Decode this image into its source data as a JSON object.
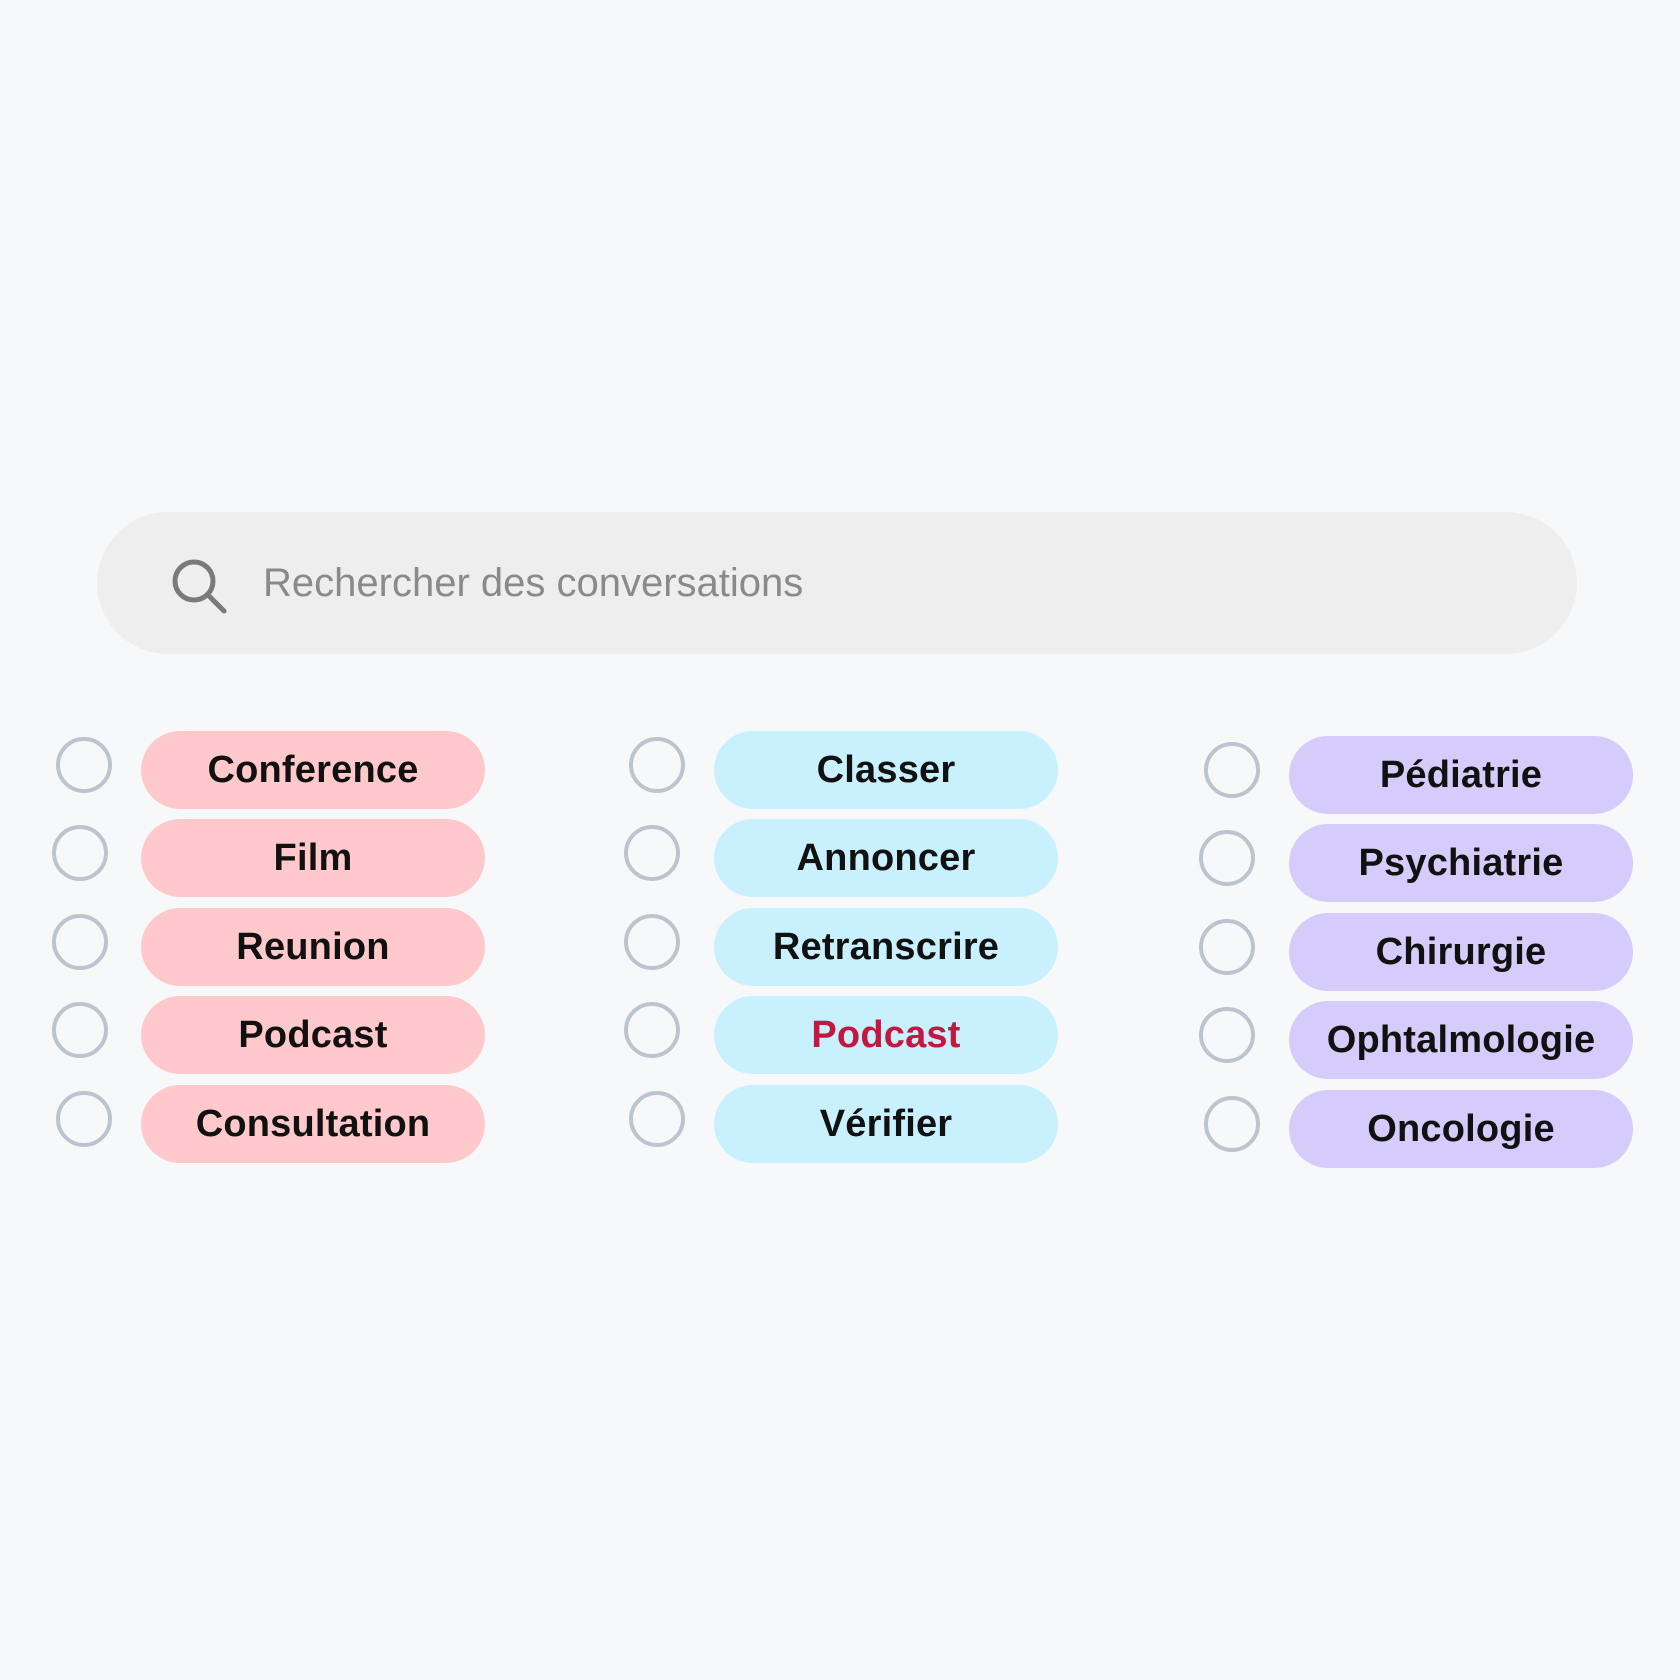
{
  "search": {
    "placeholder": "Rechercher des conversations",
    "icon": "search-icon"
  },
  "colors": {
    "background": "#f7f8fa",
    "search_bg": "#eeeeee",
    "radio_border": "#bcc4d0",
    "pill_red": "#ffc9cc",
    "pill_blue": "#c8f0fd",
    "pill_purple": "#d6ccfb",
    "highlight_text": "#c4173f"
  },
  "groups": [
    {
      "color": "red",
      "tags": [
        {
          "label": "Conference"
        },
        {
          "label": "Film"
        },
        {
          "label": "Reunion"
        },
        {
          "label": "Podcast"
        },
        {
          "label": "Consultation"
        }
      ]
    },
    {
      "color": "blue",
      "tags": [
        {
          "label": "Classer"
        },
        {
          "label": "Annoncer"
        },
        {
          "label": "Retranscrire"
        },
        {
          "label": "Podcast",
          "highlight": true
        },
        {
          "label": "Vérifier"
        }
      ]
    },
    {
      "color": "purple",
      "tags": [
        {
          "label": "Pédiatrie"
        },
        {
          "label": "Psychiatrie"
        },
        {
          "label": "Chirurgie"
        },
        {
          "label": "Ophtalmologie"
        },
        {
          "label": "Oncologie"
        }
      ]
    }
  ]
}
